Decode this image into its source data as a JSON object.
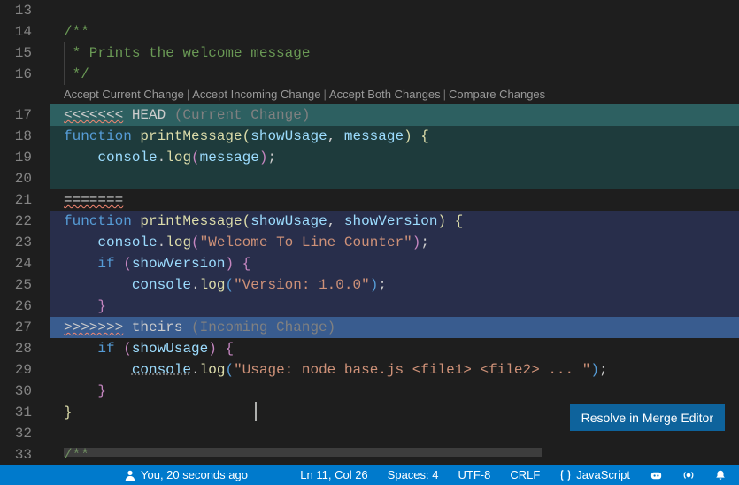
{
  "lines": {
    "l13": "13",
    "l14": "14",
    "l15": "15",
    "l16": "16",
    "l17": "17",
    "l18": "18",
    "l19": "19",
    "l20": "20",
    "l21": "21",
    "l22": "22",
    "l23": "23",
    "l24": "24",
    "l25": "25",
    "l26": "26",
    "l27": "27",
    "l28": "28",
    "l29": "29",
    "l30": "30",
    "l31": "31",
    "l32": "32",
    "l33": "33"
  },
  "code": {
    "c14": "/**",
    "c15": " * Prints the welcome message",
    "c16": " */",
    "c33": "/**"
  },
  "conflict": {
    "head_marker": "<<<<<<<",
    "head_label": " HEAD ",
    "current_hint": "(Current Change)",
    "sep_marker": "=======",
    "theirs_marker": ">>>>>>>",
    "theirs_label": " theirs ",
    "incoming_hint": "(Incoming Change)",
    "current": {
      "fn_kw": "function",
      "fn_name": " printMessage",
      "params_open": "(",
      "p1": "showUsage",
      "comma": ", ",
      "p2": "message",
      "params_close": ")",
      "brace": " {",
      "body_indent": "    ",
      "console": "console",
      "dot": ".",
      "log": "log",
      "call_open": "(",
      "arg": "message",
      "call_close": ")",
      "semi": ";"
    },
    "incoming": {
      "fn_kw": "function",
      "fn_name": " printMessage",
      "params_open": "(",
      "p1": "showUsage",
      "comma": ", ",
      "p2": "showVersion",
      "params_close": ")",
      "brace": " {",
      "l23_indent": "    ",
      "l23_console": "console",
      "l23_dot": ".",
      "l23_log": "log",
      "l23_open": "(",
      "l23_str": "\"Welcome To Line Counter\"",
      "l23_close": ")",
      "l23_semi": ";",
      "l24_indent": "    ",
      "l24_if": "if",
      "l24_sp": " ",
      "l24_open": "(",
      "l24_cond": "showVersion",
      "l24_close": ")",
      "l24_brace": " {",
      "l25_indent": "        ",
      "l25_console": "console",
      "l25_dot": ".",
      "l25_log": "log",
      "l25_open": "(",
      "l25_str": "\"Version: 1.0.0\"",
      "l25_close": ")",
      "l25_semi": ";",
      "l26_indent": "    ",
      "l26_brace": "}"
    },
    "after": {
      "l28_indent": "    ",
      "l28_if": "if",
      "l28_sp": " ",
      "l28_open": "(",
      "l28_cond": "showUsage",
      "l28_close": ")",
      "l28_brace": " {",
      "l29_indent": "        ",
      "l29_console": "console",
      "l29_dot": ".",
      "l29_log": "log",
      "l29_open": "(",
      "l29_str": "\"Usage: node base.js <file1> <file2> ... \"",
      "l29_close": ")",
      "l29_semi": ";",
      "l30_indent": "    ",
      "l30_brace": "}",
      "l31_brace": "}"
    }
  },
  "codelens": {
    "accept_current": "Accept Current Change",
    "accept_incoming": "Accept Incoming Change",
    "accept_both": "Accept Both Changes",
    "compare": "Compare Changes"
  },
  "merge_button": "Resolve in Merge Editor",
  "statusbar": {
    "blame": "You, 20 seconds ago",
    "cursor": "Ln 11, Col 26",
    "spaces": "Spaces: 4",
    "encoding": "UTF-8",
    "eol": "CRLF",
    "lang": "JavaScript"
  },
  "colors": {
    "accent": "#007acc",
    "current_header": "#2d6061",
    "incoming_header": "#395c8f"
  }
}
